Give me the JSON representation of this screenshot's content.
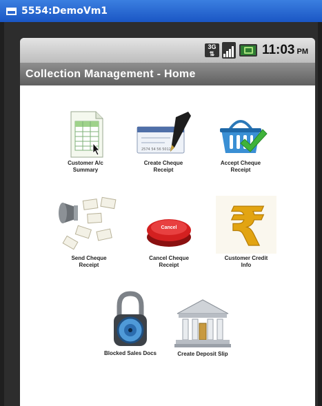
{
  "window": {
    "title": "5554:DemoVm1"
  },
  "status_bar": {
    "network": "3G",
    "time": "11:03",
    "ampm": "PM"
  },
  "app": {
    "title": "Collection Management - Home"
  },
  "tiles": [
    {
      "label": "Customer A/c\nSummary",
      "icon": "spreadsheet-icon"
    },
    {
      "label": "Create Cheque\nReceipt",
      "icon": "cheque-pen-icon"
    },
    {
      "label": "Accept Cheque\nReceipt",
      "icon": "basket-check-icon"
    },
    {
      "label": "Send Cheque\nReceipt",
      "icon": "megaphone-letters-icon"
    },
    {
      "label": "Cancel Cheque\nReceipt",
      "icon": "cancel-button-icon",
      "button_text": "Cancel"
    },
    {
      "label": "Customer Credit\nInfo",
      "icon": "rupee-icon"
    },
    {
      "label": "Blocked Sales Docs",
      "icon": "padlock-icon"
    },
    {
      "label": "Create Deposit Slip",
      "icon": "bank-icon"
    }
  ],
  "colors": {
    "window_title": "#1a56c4",
    "app_bar": "#6e6e6e",
    "status_bar": "#c8c8c8"
  }
}
